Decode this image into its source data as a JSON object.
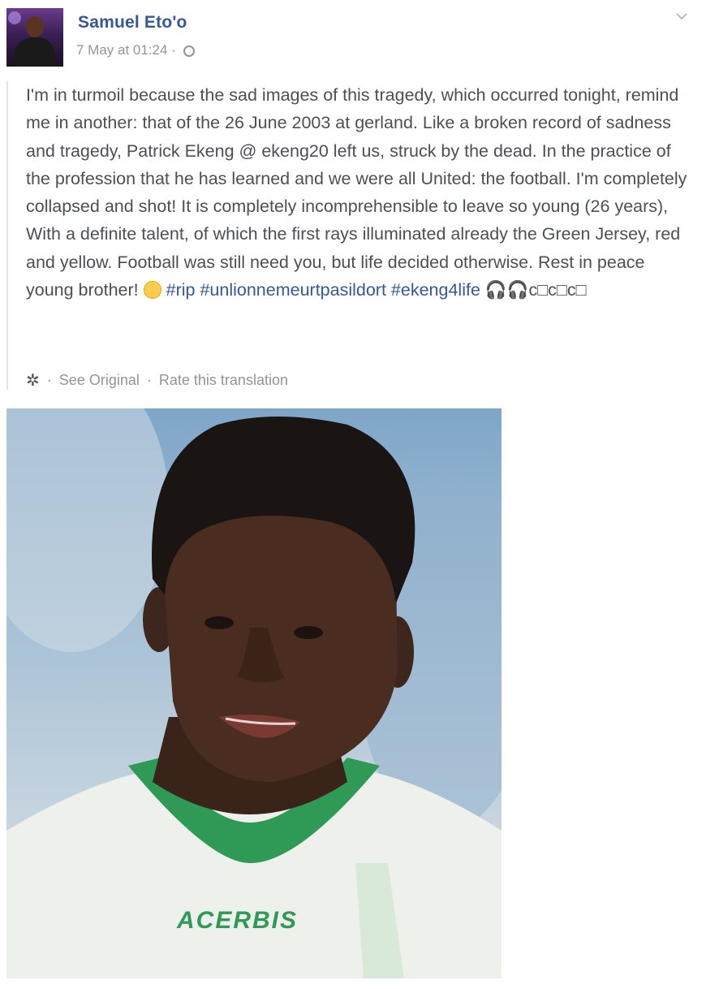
{
  "post": {
    "author_name": "Samuel Eto'o",
    "timestamp": "7 May at 01:24",
    "separator": "·",
    "body_segments": [
      "I'm in turmoil because the sad images of this tragedy, which occurred tonight, remind me in another: that of the 26 June 2003 at gerland. Like a broken record of sadness and tragedy, Patrick Ekeng @ ekeng20 left us, struck by the dead. In the practice of the profession that he has learned and we were all United: the football. I'm completely collapsed and shot! It is completely incomprehensible to leave so young (26 years), With a definite talent, of which the first rays illuminated already the Green Jersey, red and yellow. Football was still need you, but life decided otherwise. Rest in peace young brother! "
    ],
    "hashtags": [
      "#rip",
      "#unlionnemeurtpasildort",
      "#ekeng4life"
    ],
    "trailing_glyphs": "c□c□c□",
    "actions": {
      "see_original": "See Original",
      "rate_translation": "Rate this translation"
    },
    "photo": {
      "jersey_text": "ACERBIS"
    }
  }
}
